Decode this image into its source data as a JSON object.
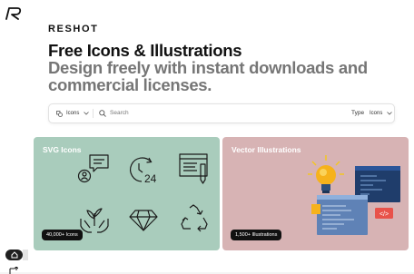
{
  "brand": {
    "name": "RESHOT"
  },
  "hero": {
    "title": "Free Icons & Illustrations",
    "subtitle": "Design freely with instant downloads and commercial licenses."
  },
  "search": {
    "category_select": "Icons",
    "placeholder": "Search",
    "type_label": "Type",
    "type_select": "Icons"
  },
  "cards": [
    {
      "title": "SVG Icons",
      "badge": "40,000+ Icons",
      "color": "#a9ccbc"
    },
    {
      "title": "Vector Illustrations",
      "badge": "1,500+ Illustrations",
      "color": "#d7b3b4"
    }
  ],
  "icons": {
    "logo": "reshot-logo-icon",
    "home": "home-icon",
    "export": "export-icon",
    "category": "category-icon",
    "search": "search-icon",
    "chevron": "chevron-down-icon",
    "clock_24": "24"
  }
}
